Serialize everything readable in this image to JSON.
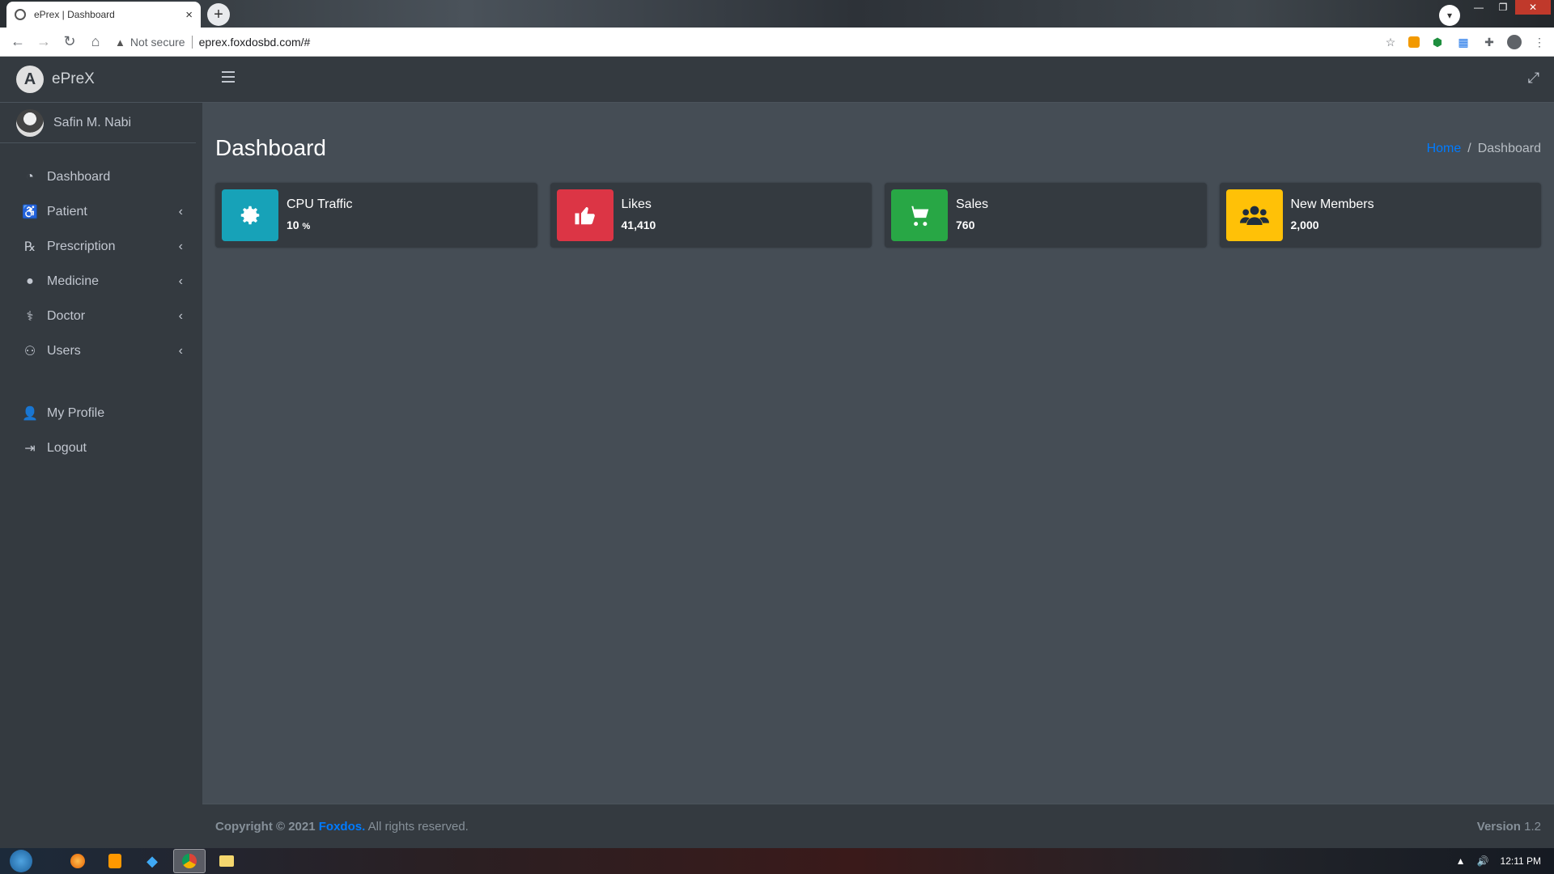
{
  "browser": {
    "tab_title": "ePrex | Dashboard",
    "tab_close": "×",
    "new_tab": "+",
    "security_label": "Not secure",
    "url": "eprex.foxdosbd.com/#"
  },
  "sidebar": {
    "brand": "ePreX",
    "user_name": "Safin M. Nabi",
    "items": [
      {
        "label": "Dashboard",
        "icon": "tachometer-icon",
        "has_children": false
      },
      {
        "label": "Patient",
        "icon": "wheelchair-icon",
        "has_children": true
      },
      {
        "label": "Prescription",
        "icon": "prescription-icon",
        "has_children": true
      },
      {
        "label": "Medicine",
        "icon": "pills-icon",
        "has_children": true
      },
      {
        "label": "Doctor",
        "icon": "doctor-icon",
        "has_children": true
      },
      {
        "label": "Users",
        "icon": "users-icon",
        "has_children": true
      }
    ],
    "bottom_items": [
      {
        "label": "My Profile",
        "icon": "user-icon"
      },
      {
        "label": "Logout",
        "icon": "sign-out-icon"
      }
    ]
  },
  "content": {
    "page_title": "Dashboard",
    "breadcrumb": {
      "home": "Home",
      "separator": "/",
      "current": "Dashboard"
    }
  },
  "info_boxes": [
    {
      "label": "CPU Traffic",
      "value": "10",
      "unit": "%",
      "color": "#17a2b8",
      "icon": "gear-icon"
    },
    {
      "label": "Likes",
      "value": "41,410",
      "unit": "",
      "color": "#dc3545",
      "icon": "thumbs-up-icon"
    },
    {
      "label": "Sales",
      "value": "760",
      "unit": "",
      "color": "#28a745",
      "icon": "shopping-cart-icon"
    },
    {
      "label": "New Members",
      "value": "2,000",
      "unit": "",
      "color": "#ffc107",
      "icon": "users-icon"
    }
  ],
  "footer": {
    "copyright_prefix": "Copyright © 2021",
    "brand_link": "Foxdos.",
    "rights": "All rights reserved.",
    "version_label": "Version",
    "version_number": "1.2"
  },
  "taskbar": {
    "clock": "12:11 PM"
  },
  "colors": {
    "sidebar_bg": "#343a40",
    "content_bg": "#454d55",
    "link": "#007bff"
  }
}
